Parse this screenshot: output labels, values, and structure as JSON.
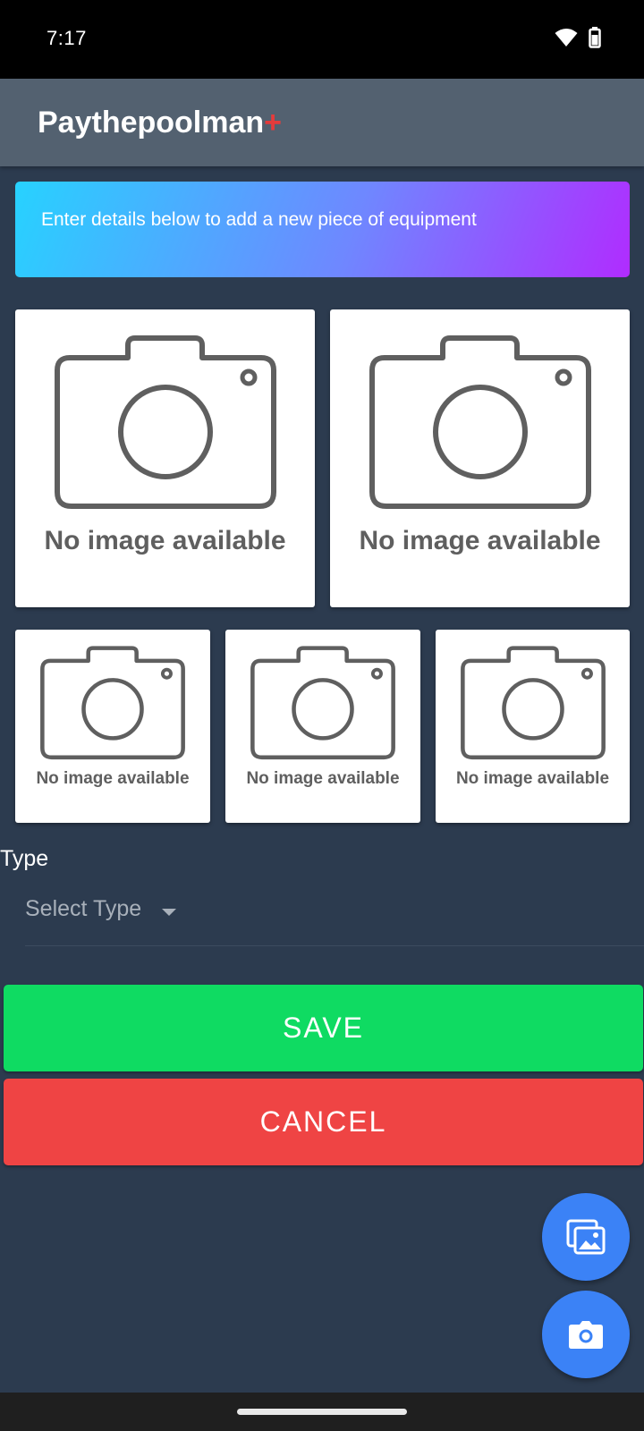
{
  "status_bar": {
    "time": "7:17",
    "icons": [
      "wifi-icon",
      "battery-icon"
    ]
  },
  "app_bar": {
    "title": "Paythepoolman",
    "title_suffix": "+",
    "suffix_color": "#e53b3b"
  },
  "banner": {
    "text": "Enter details below to add a new piece of equipment"
  },
  "photos": {
    "placeholder_caption": "No image available",
    "slots": [
      {
        "caption": "No image available"
      },
      {
        "caption": "No image available"
      },
      {
        "caption": "No image available"
      },
      {
        "caption": "No image available"
      },
      {
        "caption": "No image available"
      }
    ]
  },
  "form": {
    "type_label": "Type",
    "type_select_placeholder": "Select Type"
  },
  "actions": {
    "save_label": "SAVE",
    "cancel_label": "CANCEL",
    "save_color": "#0fdb62",
    "cancel_color": "#ef4444"
  },
  "fabs": {
    "gallery_icon": "gallery-icon",
    "camera_icon": "camera-icon",
    "color": "#3b82f6"
  }
}
